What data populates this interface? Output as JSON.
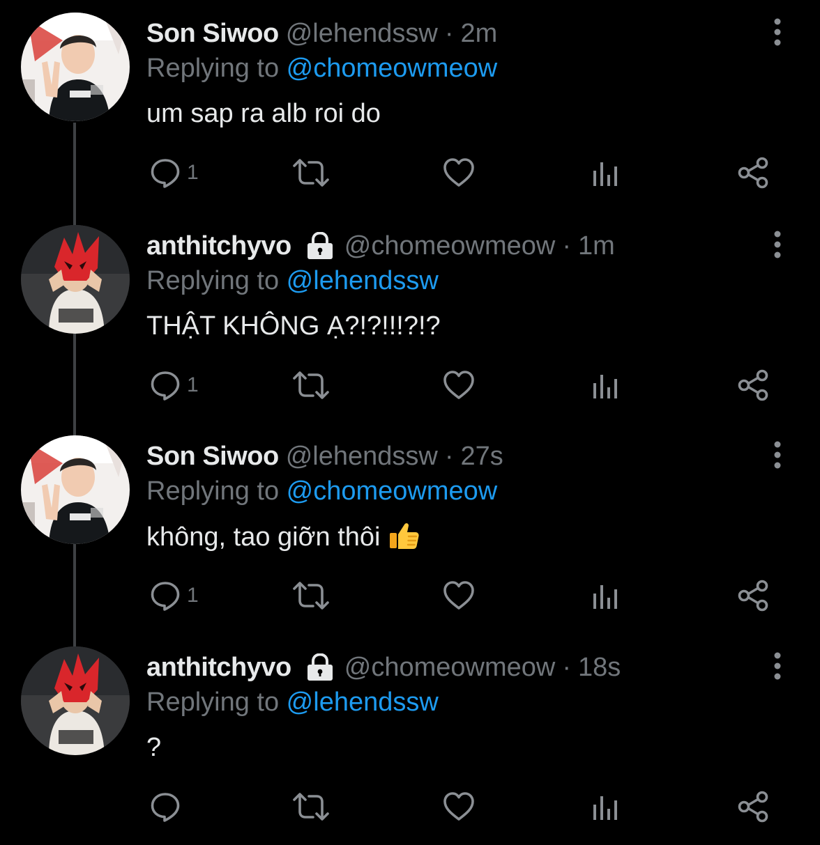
{
  "colors": {
    "background": "#000000",
    "primary_text": "#e7e9ea",
    "secondary_text": "#71767b",
    "link": "#1d9bf0",
    "thread_line": "#3e4144"
  },
  "tweets": [
    {
      "display_name": "Son Siwoo",
      "locked": false,
      "handle": "@lehendssw",
      "separator": "·",
      "time": "2m",
      "replying_prefix": "Replying to",
      "replying_to": "@chomeowmeow",
      "text": "um sap ra alb roi do",
      "emoji": null,
      "reply_count": "1",
      "avatar": "person-flash-v-sign-avatar"
    },
    {
      "display_name": "anthitchyvo",
      "locked": true,
      "handle": "@chomeowmeow",
      "separator": "·",
      "time": "1m",
      "replying_prefix": "Replying to",
      "replying_to": "@lehendssw",
      "text": "THẬT KHÔNG Ạ?!?!!!?!?",
      "emoji": null,
      "reply_count": "1",
      "avatar": "person-red-mask-avatar"
    },
    {
      "display_name": "Son Siwoo",
      "locked": false,
      "handle": "@lehendssw",
      "separator": "·",
      "time": "27s",
      "replying_prefix": "Replying to",
      "replying_to": "@chomeowmeow",
      "text": "không, tao giỡn thôi",
      "emoji": "thumbs-up-emoji",
      "reply_count": "1",
      "avatar": "person-flash-v-sign-avatar"
    },
    {
      "display_name": "anthitchyvo",
      "locked": true,
      "handle": "@chomeowmeow",
      "separator": "·",
      "time": "18s",
      "replying_prefix": "Replying to",
      "replying_to": "@lehendssw",
      "text": "?",
      "emoji": null,
      "reply_count": "",
      "avatar": "person-red-mask-avatar"
    }
  ],
  "icons": {
    "reply": "reply-bubble-icon",
    "retweet": "retweet-icon",
    "like": "heart-icon",
    "views": "views-chart-icon",
    "share": "share-icon",
    "more": "more-vertical-icon",
    "lock": "lock-icon"
  }
}
